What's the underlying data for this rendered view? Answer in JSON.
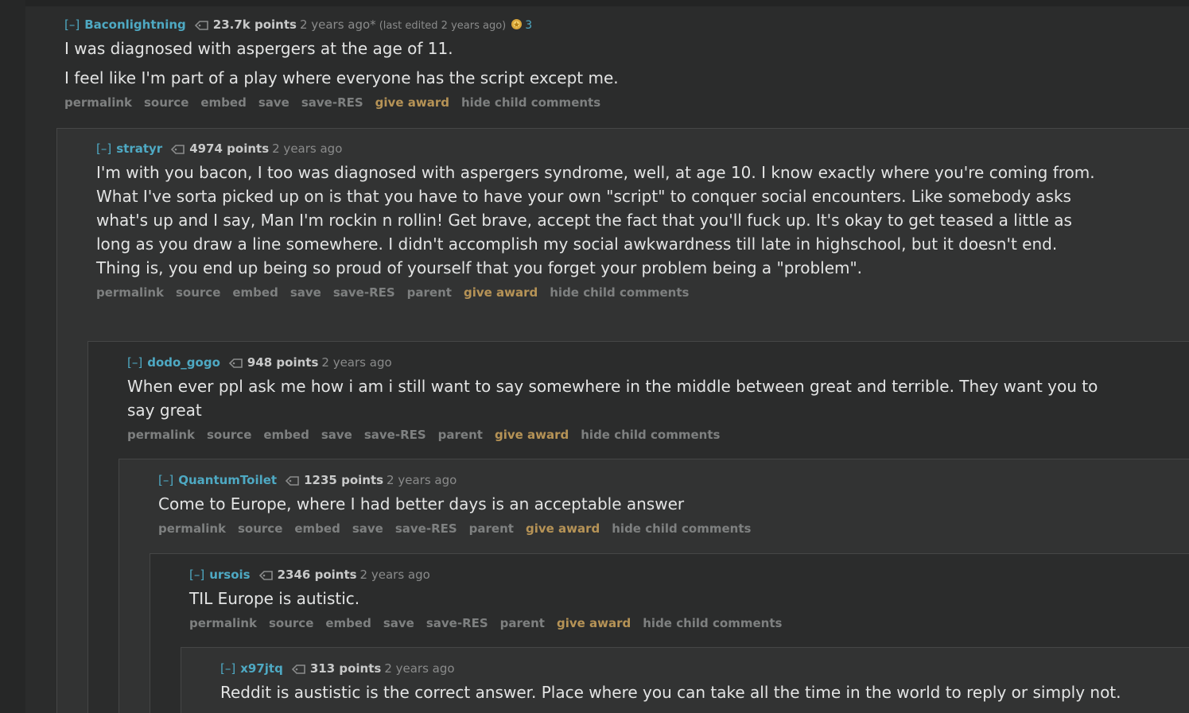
{
  "buttons": {
    "permalink": "permalink",
    "source": "source",
    "embed": "embed",
    "save": "save",
    "save_res": "save-RES",
    "parent": "parent",
    "give_award": "give award",
    "hide_child": "hide child comments"
  },
  "colors": {
    "author": "#4ea9c3",
    "award": "#b69356",
    "text": "#e3e4e4",
    "muted": "#7e8080"
  },
  "comments": [
    {
      "expand": "[–]",
      "author": "Baconlightning",
      "score": "23.7k points",
      "time": "2 years ago*",
      "edited": "(last edited 2 years ago)",
      "award_icon": "award-icon",
      "award_count": "3",
      "body": [
        "I was diagnosed with aspergers at the age of 11.",
        "I feel like I'm part of a play where everyone has the script except me."
      ]
    },
    {
      "expand": "[–]",
      "author": "stratyr",
      "score": "4974 points",
      "time": "2 years ago",
      "body": [
        "I'm with you bacon, I too was diagnosed with aspergers syndrome, well, at age 10. I know exactly where you're coming from. What I've sorta picked up on is that you have to have your own \"script\" to conquer social encounters. Like somebody asks what's up and I say, Man I'm rockin n rollin! Get brave, accept the fact that you'll fuck up. It's okay to get teased a little as long as you draw a line somewhere. I didn't accomplish my social awkwardness till late in highschool, but it doesn't end. Thing is, you end up being so proud of yourself that you forget your problem being a \"problem\"."
      ]
    },
    {
      "expand": "[–]",
      "author": "dodo_gogo",
      "score": "948 points",
      "time": "2 years ago",
      "body": [
        "When ever ppl ask me how i am i still want to say somewhere in the middle between great and terrible. They want you to say great"
      ]
    },
    {
      "expand": "[–]",
      "author": "QuantumToilet",
      "score": "1235 points",
      "time": "2 years ago",
      "body": [
        "Come to Europe, where I had better days is an acceptable answer"
      ]
    },
    {
      "expand": "[–]",
      "author": "ursois",
      "score": "2346 points",
      "time": "2 years ago",
      "body": [
        "TIL Europe is autistic."
      ]
    },
    {
      "expand": "[–]",
      "author": "x97jtq",
      "score": "313 points",
      "time": "2 years ago",
      "body": [
        "Reddit is austistic is the correct answer. Place where you can take all the time in the world to reply or simply not."
      ]
    }
  ]
}
